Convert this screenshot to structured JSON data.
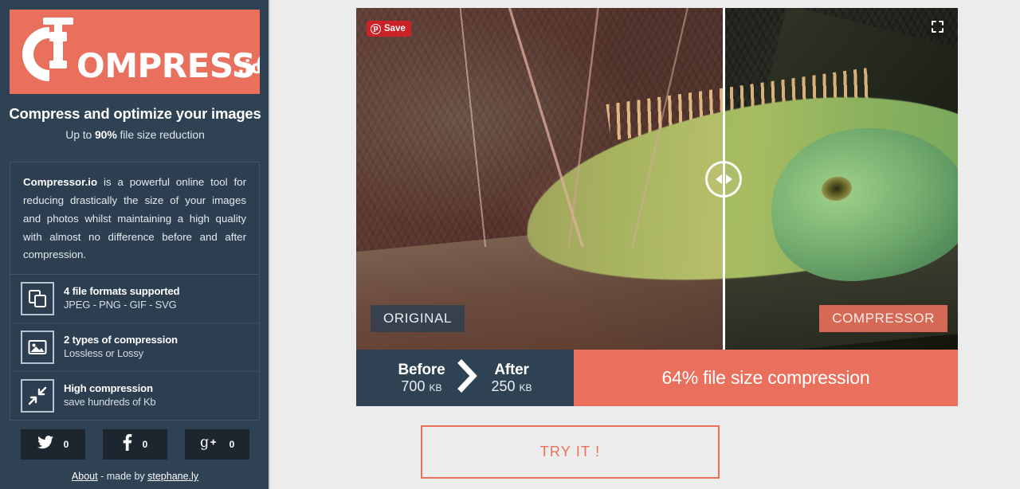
{
  "theme": {
    "accent": "#e8705c",
    "sidebar_bg": "#2f4254",
    "panel_bg": "#2c3e50",
    "main_bg": "#ececec",
    "pinterest_red": "#cc2127"
  },
  "sidebar": {
    "logo": {
      "word": "OMPRESSOR",
      "tld": ".io",
      "icon": "clamp-icon"
    },
    "tagline": "Compress and optimize your images",
    "subtagline_prefix": "Up to ",
    "subtagline_strong": "90%",
    "subtagline_suffix": " file size reduction",
    "description_strong": "Compressor.io",
    "description_rest": " is a powerful online tool for reducing drastically the size of your images and photos whilst maintaining a high quality with almost no difference before and after compression.",
    "features": [
      {
        "icon": "copy-files-icon",
        "title": "4 file formats supported",
        "sub": "JPEG - PNG - GIF - SVG"
      },
      {
        "icon": "image-icon",
        "title": "2 types of compression",
        "sub": "Lossless or Lossy"
      },
      {
        "icon": "compress-arrows-icon",
        "title": "High compression",
        "sub": "save hundreds of Kb"
      }
    ],
    "socials": [
      {
        "icon": "twitter-icon",
        "count": "0"
      },
      {
        "icon": "facebook-icon",
        "count": "0"
      },
      {
        "icon": "google-plus-icon",
        "count": "0"
      }
    ],
    "footer": {
      "about_label": "About",
      "middle": " - made by ",
      "author_label": "stephane.ly"
    }
  },
  "main": {
    "pinterest": {
      "label": "Save",
      "glyph": "p"
    },
    "fullscreen_icon": "fullscreen-expand-icon",
    "slider": {
      "left_arrow": "chevron-left-icon",
      "right_arrow": "chevron-right-icon"
    },
    "labels": {
      "original": "ORIGINAL",
      "compressor": "COMPRESSOR"
    },
    "stats": {
      "before_label": "Before",
      "before_value": "700",
      "before_unit": "KB",
      "arrow_icon": "chevron-right-icon",
      "after_label": "After",
      "after_value": "250",
      "after_unit": "KB",
      "compression_text": "64% file size compression"
    },
    "try_button": "TRY IT !"
  }
}
